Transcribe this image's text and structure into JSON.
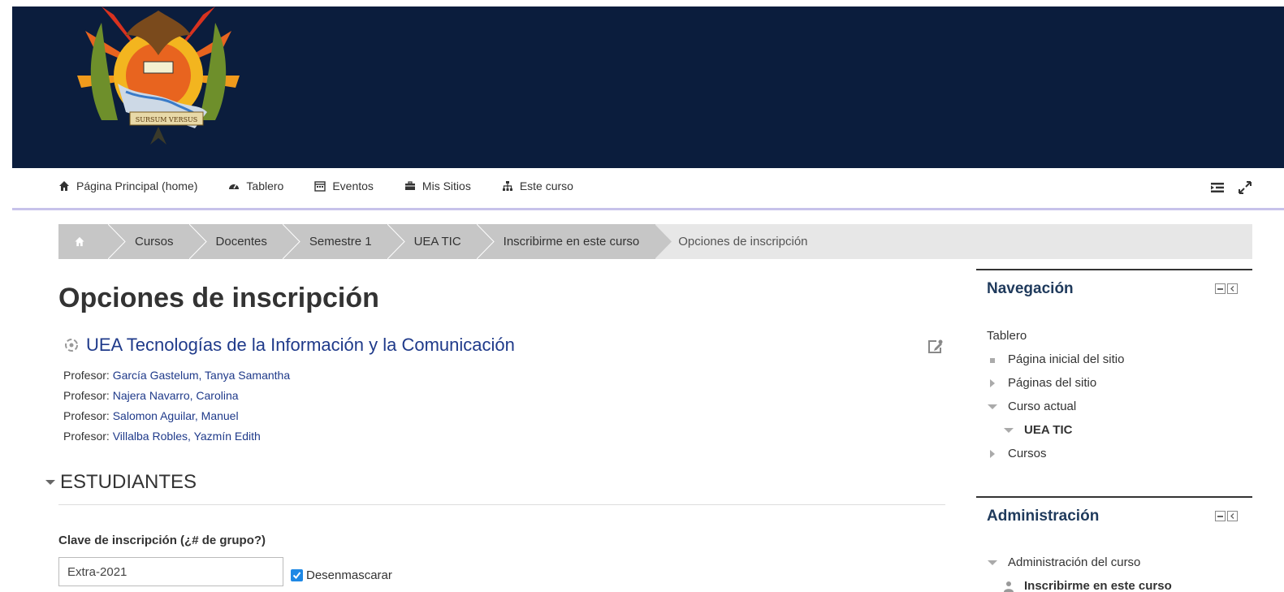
{
  "nav": {
    "items": [
      {
        "label": "Página Principal (home)",
        "icon": "home-icon"
      },
      {
        "label": "Tablero",
        "icon": "dashboard-icon"
      },
      {
        "label": "Eventos",
        "icon": "calendar-icon"
      },
      {
        "label": "Mis Sitios",
        "icon": "briefcase-icon"
      },
      {
        "label": "Este curso",
        "icon": "sitemap-icon"
      }
    ]
  },
  "breadcrumb": {
    "items": [
      "Cursos",
      "Docentes",
      "Semestre 1",
      "UEA TIC",
      "Inscribirme en este curso"
    ],
    "current": "Opciones de inscripción"
  },
  "page": {
    "title": "Opciones de inscripción",
    "course_title": "UEA Tecnologías de la Información y la Comunicación",
    "teachers": [
      {
        "label": "Profesor:",
        "name": "García Gastelum, Tanya Samantha"
      },
      {
        "label": "Profesor:",
        "name": "Najera Navarro, Carolina"
      },
      {
        "label": "Profesor:",
        "name": "Salomon Aguilar, Manuel"
      },
      {
        "label": "Profesor:",
        "name": "Villalba Robles, Yazmín Edith"
      }
    ],
    "section": "ESTUDIANTES",
    "field_label": "Clave de inscripción (¿# de grupo?)",
    "key_value": "Extra-2021",
    "unmask_label": "Desenmascarar"
  },
  "navigation_block": {
    "title": "Navegación",
    "root": "Tablero",
    "items": [
      {
        "label": "Página inicial del sitio",
        "type": "leaf"
      },
      {
        "label": "Páginas del sitio",
        "type": "collapsed"
      },
      {
        "label": "Curso actual",
        "type": "expanded"
      },
      {
        "label": "UEA TIC",
        "type": "expanded-child"
      },
      {
        "label": "Cursos",
        "type": "collapsed"
      }
    ]
  },
  "admin_block": {
    "title": "Administración",
    "items": [
      {
        "label": "Administración del curso"
      },
      {
        "label": "Inscribirme en este curso"
      }
    ]
  },
  "banner": {
    "logo_text": "SURSUM VERSUS"
  }
}
